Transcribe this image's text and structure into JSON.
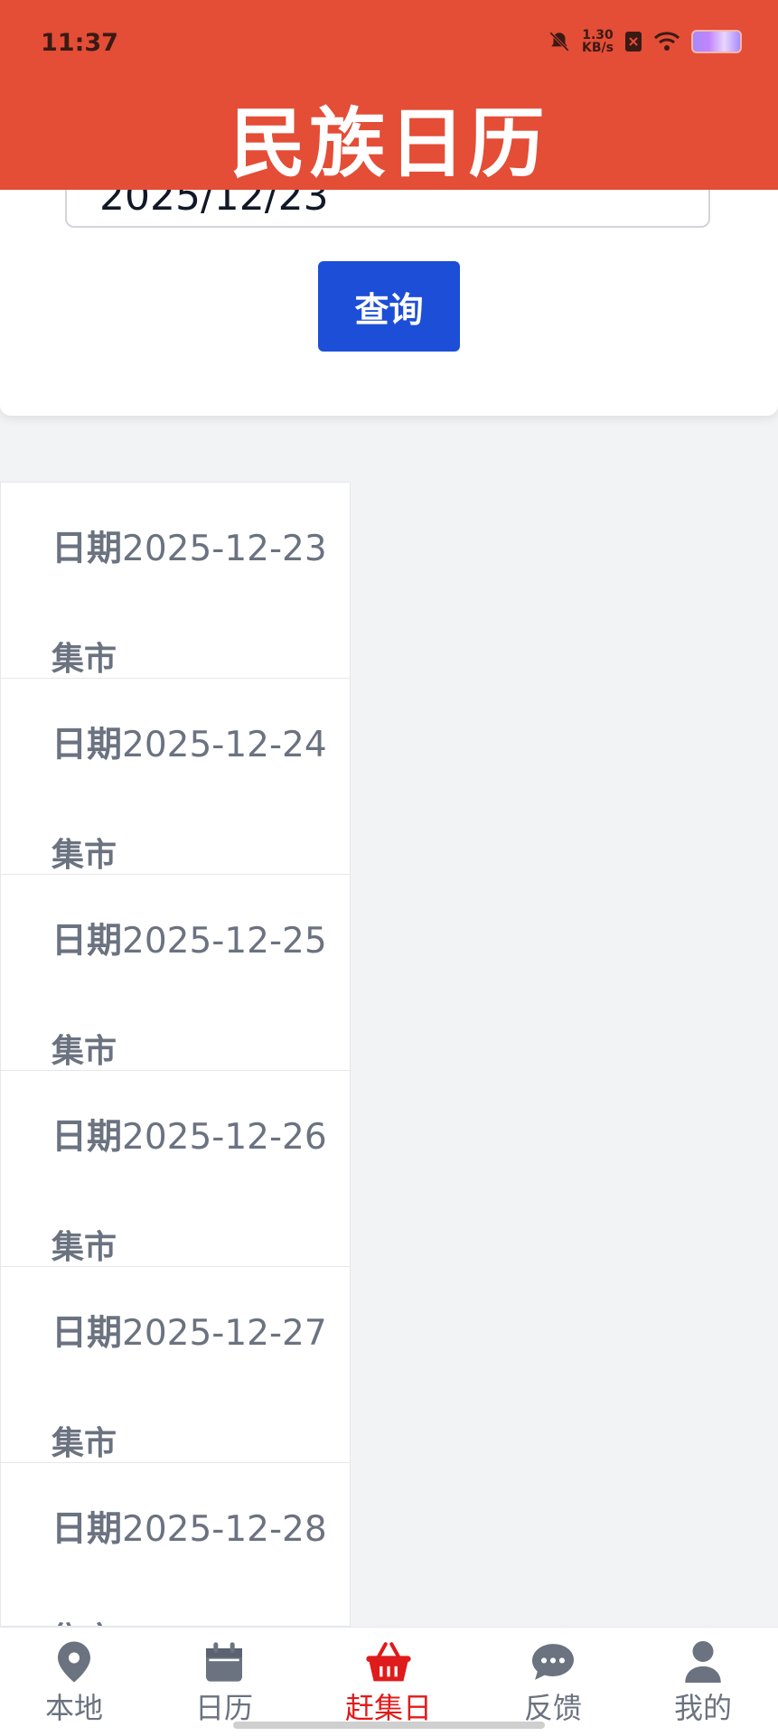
{
  "status_bar": {
    "time": "11:37",
    "net_speed_value": "1.30",
    "net_speed_unit": "KB/s"
  },
  "header": {
    "title": "民族日历"
  },
  "search": {
    "date_value": "2025/12/23",
    "query_label": "查询"
  },
  "results": {
    "date_label": "日期",
    "market_label": "集市",
    "items": [
      {
        "date": "2025-12-23"
      },
      {
        "date": "2025-12-24"
      },
      {
        "date": "2025-12-25"
      },
      {
        "date": "2025-12-26"
      },
      {
        "date": "2025-12-27"
      },
      {
        "date": "2025-12-28"
      }
    ]
  },
  "bottom_nav": {
    "active_color": "#e01b1b",
    "inactive_color": "#6b7280",
    "items": [
      {
        "label": "本地",
        "icon": "location-pin-icon"
      },
      {
        "label": "日历",
        "icon": "calendar-icon"
      },
      {
        "label": "赶集日",
        "icon": "basket-icon",
        "active": true
      },
      {
        "label": "反馈",
        "icon": "chat-bubble-icon"
      },
      {
        "label": "我的",
        "icon": "user-icon"
      }
    ]
  },
  "colors": {
    "header_bg": "#e44d36",
    "primary_button": "#1d4ed8"
  }
}
